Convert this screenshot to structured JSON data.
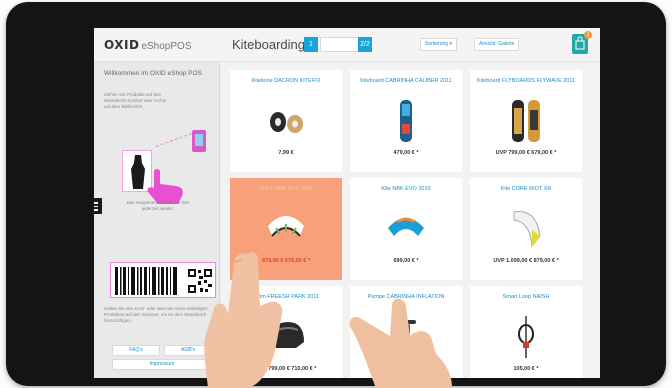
{
  "header": {
    "logo_main": "OXID",
    "logo_sub": "eShopPOS",
    "category": "Kiteboarding",
    "pager_left": "1",
    "pager_right": "2/2",
    "sort_label": "Sortierung",
    "view_label": "Ansicht: Galerie",
    "cart_count": "1"
  },
  "sidebar": {
    "welcome": "Willkommen im OXID eShop POS",
    "hint_tap": "Ziehen Sie Produkte auf das Warenkorb-Symbol oder rechts auf dem Bildschirm.",
    "hint_menu": "Das Hauptmenü öffnen Sie hier jederzeit wieder.",
    "hint_scan": "Halten Sie den EAN- oder Barcode eines beliebigen Produktes auf den Scanner, um es dem Warenkorb hinzuzufügen.",
    "btn_faq": "FAQ's",
    "btn_agb": "AGB's",
    "btn_imprint": "Impressum"
  },
  "products": [
    {
      "title": "Kiteleine DACRON KITEFIX",
      "price": "7,99 €",
      "icon": "kite-lines-icon"
    },
    {
      "title": "Kiteboard CABRINHA CALIBER 2011",
      "price": "479,00 € *",
      "icon": "kiteboard-icon"
    },
    {
      "title": "Kiteboard FLYBOARDS FLYWAVE 2011",
      "price": "UVP 799,00 € 679,00 € *",
      "icon": "kiteboard-wooden-icon"
    },
    {
      "title": "Kite CORE GTS 2011",
      "price": "879,00 € 679,00 € *",
      "icon": "kite-icon",
      "active": true
    },
    {
      "title": "Kite NBK EVO 2010",
      "price": "699,00 € *",
      "icon": "kite-blue-icon"
    },
    {
      "title": "Kite CORE RIOT XR",
      "price": "UVP 1.099,00 € 879,00 € *",
      "icon": "kite-yellow-icon"
    },
    {
      "title": "Helm FREESH PARK 2011",
      "price": "UVP 799,00 € 710,00 € *",
      "icon": "helmet-icon"
    },
    {
      "title": "Pumpe CABRINHA INFLATION",
      "price": "",
      "icon": "pump-icon"
    },
    {
      "title": "Smart Loop NAISH",
      "price": "105,00 € *",
      "icon": "smart-loop-icon"
    }
  ],
  "colors": {
    "accent": "#1aa3d6",
    "highlight": "#f8a07a",
    "pink": "#e98ad9",
    "cart": "#21a9a5"
  }
}
